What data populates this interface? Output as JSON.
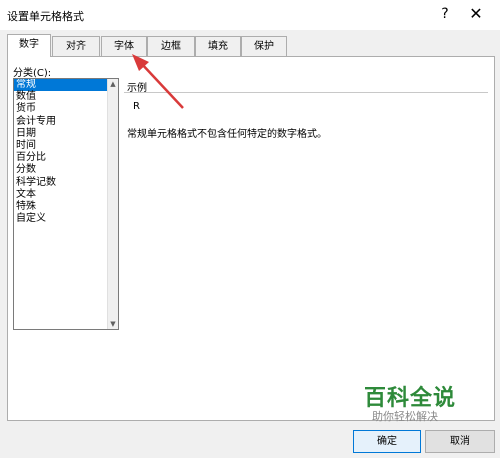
{
  "window": {
    "title": "设置单元格格式",
    "help_glyph": "?",
    "close_glyph": "✕"
  },
  "tabs": [
    {
      "label": "数字",
      "active": true
    },
    {
      "label": "对齐",
      "active": false
    },
    {
      "label": "字体",
      "active": false
    },
    {
      "label": "边框",
      "active": false
    },
    {
      "label": "填充",
      "active": false
    },
    {
      "label": "保护",
      "active": false
    }
  ],
  "category": {
    "label": "分类(C):",
    "items": [
      "常规",
      "数值",
      "货币",
      "会计专用",
      "日期",
      "时间",
      "百分比",
      "分数",
      "科学记数",
      "文本",
      "特殊",
      "自定义"
    ],
    "selected_index": 0
  },
  "sample": {
    "label": "示例",
    "value": "R"
  },
  "description": "常规单元格格式不包含任何特定的数字格式。",
  "watermark": {
    "main": "百科全说",
    "sub": "助你轻松解决"
  },
  "buttons": {
    "ok": "确定",
    "cancel": "取消"
  },
  "colors": {
    "selection": "#0078d7",
    "arrow": "#d93a3a",
    "watermark": "#2e8a3a"
  }
}
